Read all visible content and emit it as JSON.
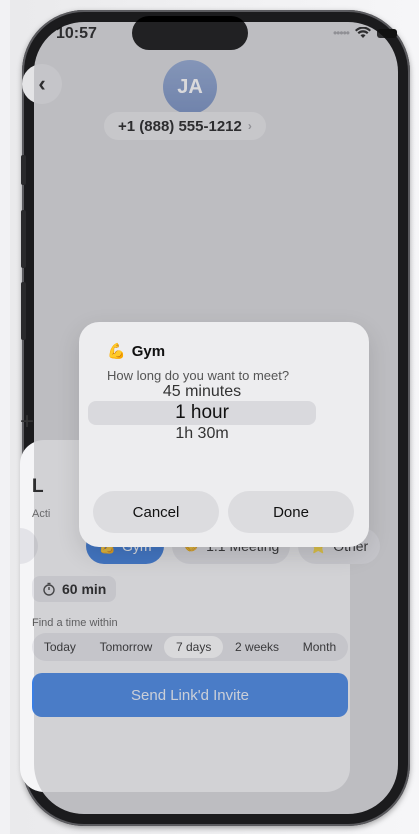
{
  "status": {
    "time": "10:57"
  },
  "contact": {
    "initials": "JA",
    "phone": "+1 (888) 555-1212"
  },
  "card": {
    "title": "L",
    "activity_label": "Acti",
    "activities": [
      {
        "label": "Gym",
        "emoji": "💪",
        "active": true
      },
      {
        "label": "1:1 Meeting",
        "emoji": "🤝",
        "active": false
      },
      {
        "label": "Other",
        "emoji": "⭐",
        "active": false
      }
    ],
    "duration": "60 min",
    "find_label": "Find a time within",
    "ranges": [
      "Today",
      "Tomorrow",
      "7 days",
      "2 weeks",
      "Month"
    ],
    "active_range": "7 days",
    "send_label": "Send Link'd Invite"
  },
  "modal": {
    "title": "Gym",
    "title_emoji": "💪",
    "question": "How long do you want to meet?",
    "options": [
      "45 minutes",
      "1 hour",
      "1h 30m"
    ],
    "selected": "1 hour",
    "cancel_label": "Cancel",
    "done_label": "Done"
  }
}
